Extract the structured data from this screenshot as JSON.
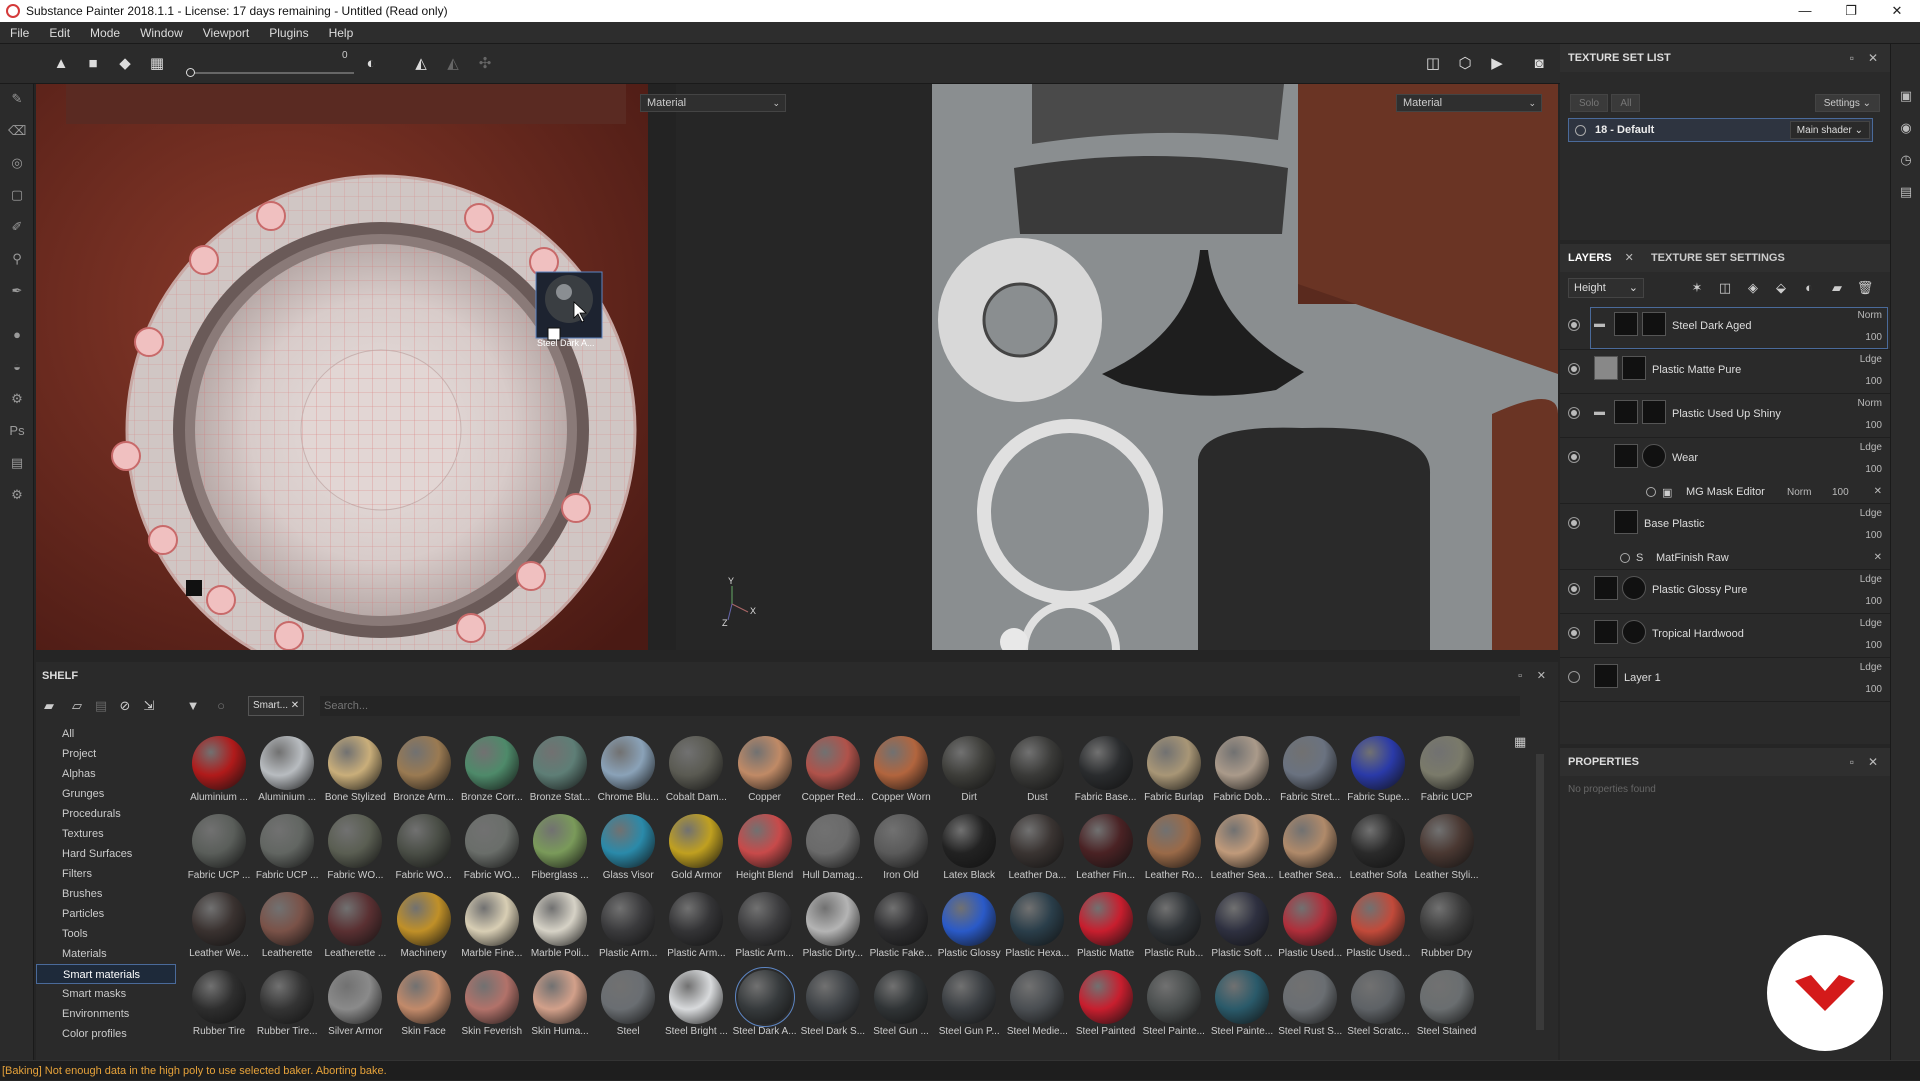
{
  "window": {
    "title": "Substance Painter 2018.1.1 - License: 17 days remaining - Untitled (Read only)",
    "buttons": [
      "—",
      "❐",
      "✕"
    ]
  },
  "menu": [
    "File",
    "Edit",
    "Mode",
    "Window",
    "Viewport",
    "Plugins",
    "Help"
  ],
  "toolbar": {
    "slider_value": "0"
  },
  "viewport3d": {
    "mode": "Material",
    "dragged_material": "Steel Dark A...",
    "axis_y": "Y",
    "axis_x": "X",
    "axis_z": "Z"
  },
  "viewport2d": {
    "mode": "Material"
  },
  "texture_set_list": {
    "title": "TEXTURE SET LIST",
    "solo": "Solo",
    "all": "All",
    "settings": "Settings",
    "item": "18 - Default",
    "shader": "Main shader"
  },
  "layers_panel": {
    "tab_layers": "LAYERS",
    "tab_tss": "TEXTURE SET SETTINGS",
    "channel": "Height",
    "layers": [
      {
        "name": "Steel Dark Aged",
        "blend": "Norm",
        "opacity": "100"
      },
      {
        "name": "Plastic Matte Pure",
        "blend": "Ldge",
        "opacity": "100"
      },
      {
        "name": "Plastic Used Up Shiny",
        "blend": "Norm",
        "opacity": "100"
      },
      {
        "name": "Wear",
        "blend": "Ldge",
        "opacity": "100"
      },
      {
        "name": "Base Plastic",
        "blend": "Ldge",
        "opacity": "100"
      },
      {
        "name": "Plastic Glossy Pure",
        "blend": "Ldge",
        "opacity": "100"
      },
      {
        "name": "Tropical Hardwood",
        "blend": "Ldge",
        "opacity": "100"
      },
      {
        "name": "Layer 1",
        "blend": "Ldge",
        "opacity": "100"
      }
    ],
    "mg_mask": {
      "name": "MG Mask Editor",
      "blend": "Norm",
      "opacity": "100"
    },
    "matfinish": {
      "name": "MatFinish Raw"
    }
  },
  "properties": {
    "title": "PROPERTIES",
    "empty": "No properties found"
  },
  "shelf": {
    "title": "SHELF",
    "filter_tag": "Smart...",
    "search_placeholder": "Search...",
    "categories": [
      "All",
      "Project",
      "Alphas",
      "Grunges",
      "Procedurals",
      "Textures",
      "Hard Surfaces",
      "Filters",
      "Brushes",
      "Particles",
      "Tools",
      "Materials",
      "Smart materials",
      "Smart masks",
      "Environments",
      "Color profiles"
    ],
    "selected_category": "Smart materials",
    "materials": [
      {
        "name": "Aluminium ...",
        "color": "#b01a1a"
      },
      {
        "name": "Aluminium ...",
        "color": "#b8bcc0"
      },
      {
        "name": "Bone Stylized",
        "color": "#c9ae7a"
      },
      {
        "name": "Bronze Arm...",
        "color": "#9a7a52"
      },
      {
        "name": "Bronze Corr...",
        "color": "#4e8a6a"
      },
      {
        "name": "Bronze Stat...",
        "color": "#5e7e76"
      },
      {
        "name": "Chrome Blu...",
        "color": "#8aa2b8"
      },
      {
        "name": "Cobalt Dam...",
        "color": "#5a5a52"
      },
      {
        "name": "Copper",
        "color": "#c08a66"
      },
      {
        "name": "Copper Red...",
        "color": "#b0524a"
      },
      {
        "name": "Copper Worn",
        "color": "#b2653e"
      },
      {
        "name": "Dirt",
        "color": "#3e3e3a"
      },
      {
        "name": "Dust",
        "color": "#3a3a38"
      },
      {
        "name": "Fabric Base...",
        "color": "#2a2c2e"
      },
      {
        "name": "Fabric Burlap",
        "color": "#a89676"
      },
      {
        "name": "Fabric Dob...",
        "color": "#aa9a8a"
      },
      {
        "name": "Fabric Stret...",
        "color": "#6a7280"
      },
      {
        "name": "Fabric Supe...",
        "color": "#2a3aa8"
      },
      {
        "name": "Fabric UCP",
        "color": "#7a7a6a"
      },
      {
        "name": "Fabric UCP ...",
        "color": "#5a5e5a"
      },
      {
        "name": "Fabric UCP ...",
        "color": "#626662"
      },
      {
        "name": "Fabric WO...",
        "color": "#5a5e52"
      },
      {
        "name": "Fabric WO...",
        "color": "#4a4e46"
      },
      {
        "name": "Fabric WO...",
        "color": "#6a6e6a"
      },
      {
        "name": "Fiberglass ...",
        "color": "#7a9a5a"
      },
      {
        "name": "Glass Visor",
        "color": "#2a8aaa"
      },
      {
        "name": "Gold Armor",
        "color": "#c0a020"
      },
      {
        "name": "Height Blend",
        "color": "#c84a4a"
      },
      {
        "name": "Hull Damag...",
        "color": "#6a6a6a"
      },
      {
        "name": "Iron Old",
        "color": "#5a5a5a"
      },
      {
        "name": "Latex Black",
        "color": "#222"
      },
      {
        "name": "Leather Da...",
        "color": "#3a3432"
      },
      {
        "name": "Leather Fin...",
        "color": "#4a2224"
      },
      {
        "name": "Leather Ro...",
        "color": "#9a6a48"
      },
      {
        "name": "Leather Sea...",
        "color": "#c09a7a"
      },
      {
        "name": "Leather Sea...",
        "color": "#b08a6a"
      },
      {
        "name": "Leather Sofa",
        "color": "#2a2a2a"
      },
      {
        "name": "Leather Styli...",
        "color": "#4a3832"
      },
      {
        "name": "Leather We...",
        "color": "#3a3230"
      },
      {
        "name": "Leatherette",
        "color": "#7a5248"
      },
      {
        "name": "Leatherette ...",
        "color": "#5a3032"
      },
      {
        "name": "Machinery",
        "color": "#c09028"
      },
      {
        "name": "Marble Fine...",
        "color": "#d8ceb4"
      },
      {
        "name": "Marble Poli...",
        "color": "#d6d2c6"
      },
      {
        "name": "Plastic Arm...",
        "color": "#3a3a3c"
      },
      {
        "name": "Plastic Arm...",
        "color": "#343436"
      },
      {
        "name": "Plastic Arm...",
        "color": "#3c3c3e"
      },
      {
        "name": "Plastic Dirty...",
        "color": "#b4b4b4"
      },
      {
        "name": "Plastic Fake...",
        "color": "#2e2e30"
      },
      {
        "name": "Plastic Glossy",
        "color": "#2a5ac8"
      },
      {
        "name": "Plastic Hexa...",
        "color": "#2a3e4a"
      },
      {
        "name": "Plastic Matte",
        "color": "#c81e2e"
      },
      {
        "name": "Plastic Rub...",
        "color": "#2e3236"
      },
      {
        "name": "Plastic Soft ...",
        "color": "#2e3040"
      },
      {
        "name": "Plastic Used...",
        "color": "#b02e3a"
      },
      {
        "name": "Plastic Used...",
        "color": "#c24a3a"
      },
      {
        "name": "Rubber Dry",
        "color": "#3a3a3a"
      },
      {
        "name": "Rubber Tire",
        "color": "#2e2e2e"
      },
      {
        "name": "Rubber Tire...",
        "color": "#343434"
      },
      {
        "name": "Silver Armor",
        "color": "#8a8a8a"
      },
      {
        "name": "Skin Face",
        "color": "#c28a6a"
      },
      {
        "name": "Skin Feverish",
        "color": "#b2726a"
      },
      {
        "name": "Skin Huma...",
        "color": "#d2a08a"
      },
      {
        "name": "Steel",
        "color": "#6a6e72"
      },
      {
        "name": "Steel Bright ...",
        "color": "#d8dadc"
      },
      {
        "name": "Steel Dark A...",
        "color": "#363a3c"
      },
      {
        "name": "Steel Dark S...",
        "color": "#3e4246"
      },
      {
        "name": "Steel Gun ...",
        "color": "#303436"
      },
      {
        "name": "Steel Gun P...",
        "color": "#3a3e42"
      },
      {
        "name": "Steel Medie...",
        "color": "#4a4e52"
      },
      {
        "name": "Steel Painted",
        "color": "#c81e2e"
      },
      {
        "name": "Steel Painte...",
        "color": "#4a4e4e"
      },
      {
        "name": "Steel Painte...",
        "color": "#2a5a6a"
      },
      {
        "name": "Steel Rust S...",
        "color": "#6a6e72"
      },
      {
        "name": "Steel Scratc...",
        "color": "#5e6266"
      },
      {
        "name": "Steel Stained",
        "color": "#6a6e70"
      }
    ],
    "selected_material": "Steel Dark A..."
  },
  "status": "[Baking] Not enough data in the high poly to use selected baker. Aborting bake."
}
